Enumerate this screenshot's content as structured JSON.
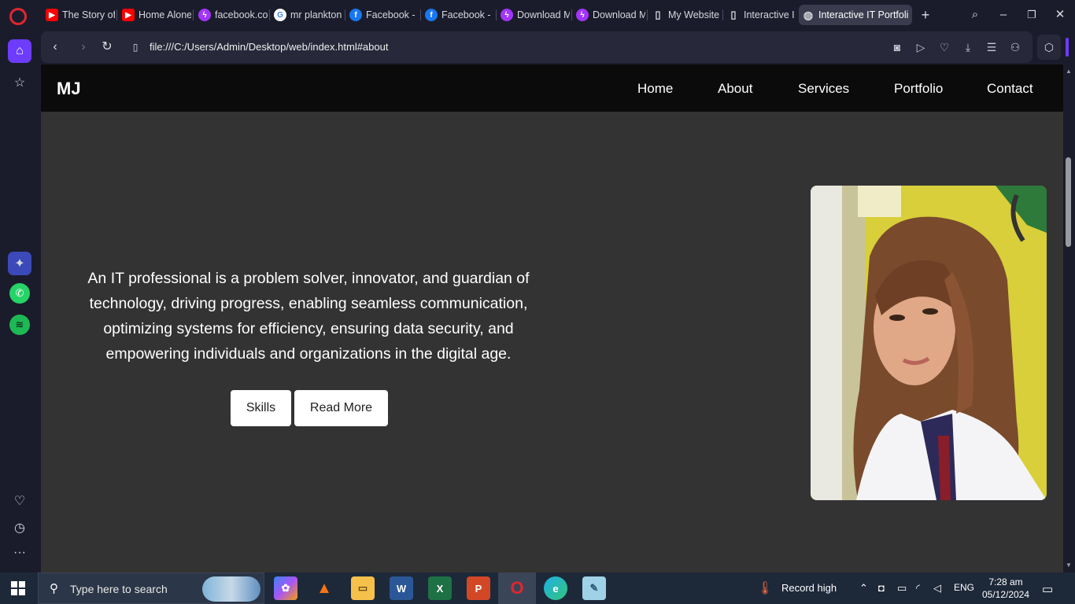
{
  "tabs": [
    {
      "label": "The Story of",
      "icon": "youtube-icon",
      "color": "#ff0000"
    },
    {
      "label": "Home Alone",
      "icon": "youtube-icon",
      "color": "#ff0000"
    },
    {
      "label": "facebook.co",
      "icon": "messenger-icon",
      "color": "#a334fa"
    },
    {
      "label": "mr plankton",
      "icon": "google-icon",
      "color": "#4285f4"
    },
    {
      "label": "Facebook - I",
      "icon": "facebook-icon",
      "color": "#1877f2"
    },
    {
      "label": "Facebook - I",
      "icon": "facebook-icon",
      "color": "#1877f2"
    },
    {
      "label": "Download M",
      "icon": "messenger-icon",
      "color": "#a334fa"
    },
    {
      "label": "Download M",
      "icon": "messenger-icon",
      "color": "#a334fa"
    },
    {
      "label": "My Website",
      "icon": "file-icon",
      "color": "#d7d7de"
    },
    {
      "label": "Interactive I",
      "icon": "file-icon",
      "color": "#d7d7de"
    },
    {
      "label": "Interactive IT Portfolio",
      "icon": "globe-icon",
      "color": "#d7d7de",
      "active": true
    }
  ],
  "address": {
    "url": "file:///C:/Users/Admin/Desktop/web/index.html#about"
  },
  "site": {
    "brand": "MJ",
    "nav": [
      "Home",
      "About",
      "Services",
      "Portfolio",
      "Contact"
    ],
    "about_text": "An IT professional is a problem solver, innovator, and guardian of technology, driving progress, enabling seamless communication, optimizing systems for efficiency, ensuring data security, and empowering individuals and organizations in the digital age.",
    "buttons": {
      "skills": "Skills",
      "read_more": "Read More"
    }
  },
  "taskbar": {
    "search_placeholder": "Type here to search",
    "weather": "Record high",
    "language": "ENG",
    "time": "7:28 am",
    "date": "05/12/2024"
  },
  "colors": {
    "accent": "#6d3cff",
    "opera_red": "#e0262f",
    "page_bg": "#333333",
    "nav_bg": "#0b0b0b"
  }
}
